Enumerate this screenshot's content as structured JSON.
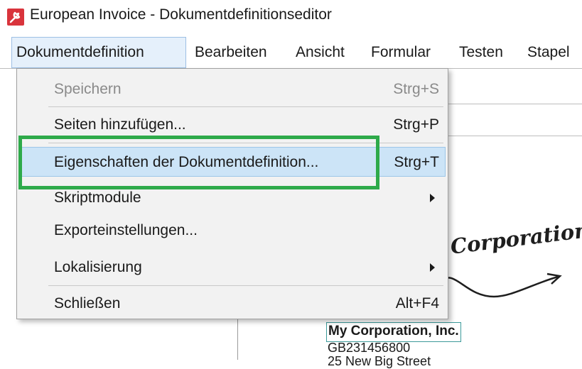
{
  "window": {
    "title": "European Invoice - Dokumentdefinitionseditor",
    "icon": "wrench-icon",
    "icon_color": "#d9343c"
  },
  "menubar": {
    "items": [
      {
        "label": "Dokumentdefinition"
      },
      {
        "label": "Bearbeiten"
      },
      {
        "label": "Ansicht"
      },
      {
        "label": "Formular"
      },
      {
        "label": "Testen"
      },
      {
        "label": "Stapel"
      }
    ]
  },
  "dropdown": {
    "items": [
      {
        "label": "Speichern",
        "shortcut": "Strg+S",
        "enabled": false
      },
      {
        "label": "Seiten hinzufügen...",
        "shortcut": "Strg+P",
        "enabled": true
      },
      {
        "label": "Eigenschaften der Dokumentdefinition...",
        "shortcut": "Strg+T",
        "enabled": true,
        "highlighted": true
      },
      {
        "label": "Skriptmodule",
        "submenu": true,
        "enabled": true
      },
      {
        "label": "Exporteinstellungen...",
        "enabled": true
      },
      {
        "label": "Lokalisierung",
        "submenu": true,
        "enabled": true
      },
      {
        "label": "Schließen",
        "shortcut": "Alt+F4",
        "enabled": true
      }
    ]
  },
  "document": {
    "logo_text": "Corporation",
    "company_name": "My Corporation, Inc.",
    "vat_number": "GB231456800",
    "street_partial": "25 New Big Street"
  },
  "colors": {
    "annotation": "#2eaa4a",
    "highlight": "#cce4f7",
    "menu_background": "#f2f2f2"
  }
}
